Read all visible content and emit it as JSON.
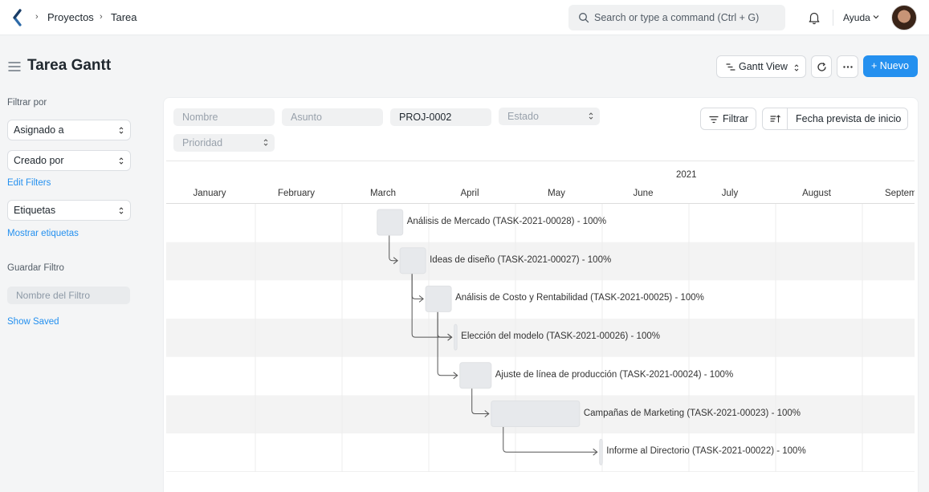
{
  "navbar": {
    "breadcrumbs": [
      "Proyectos",
      "Tarea"
    ],
    "search_placeholder": "Search or type a command (Ctrl + G)",
    "help_label": "Ayuda"
  },
  "page": {
    "title": "Tarea Gantt",
    "view_label": "Gantt View",
    "new_label": "+ Nuevo"
  },
  "sidebar": {
    "filter_by": "Filtrar por",
    "assigned_to": "Asignado a",
    "created_by": "Creado por",
    "edit_filters": "Edit Filters",
    "tags": "Etiquetas",
    "show_tags": "Mostrar etiquetas",
    "save_filter": "Guardar Filtro",
    "filter_name_placeholder": "Nombre del Filtro",
    "show_saved": "Show Saved"
  },
  "filters": {
    "name_placeholder": "Nombre",
    "subject_placeholder": "Asunto",
    "project_value": "PROJ-0002",
    "status_placeholder": "Estado",
    "priority_placeholder": "Prioridad",
    "filter_button": "Filtrar",
    "sort_label": "Fecha prevista de inicio"
  },
  "gantt": {
    "year": "2021",
    "months": [
      "January",
      "February",
      "March",
      "April",
      "May",
      "June",
      "July",
      "August",
      "Septemb"
    ],
    "tasks": [
      {
        "label": "Análisis de Mercado (TASK-2021-00028) - 100%",
        "start": "2021-03-16",
        "end": "2021-03-25"
      },
      {
        "label": "Ideas de diseño (TASK-2021-00027) - 100%",
        "start": "2021-03-24",
        "end": "2021-04-02"
      },
      {
        "label": "Análisis de Costo y Rentabilidad (TASK-2021-00025) - 100%",
        "start": "2021-04-02",
        "end": "2021-04-11"
      },
      {
        "label": "Elección del modelo (TASK-2021-00026) - 100%",
        "start": "2021-04-12",
        "end": "2021-04-13"
      },
      {
        "label": "Ajuste de línea de producción (TASK-2021-00024) - 100%",
        "start": "2021-04-14",
        "end": "2021-04-25"
      },
      {
        "label": "Campañas de Marketing (TASK-2021-00023) - 100%",
        "start": "2021-04-25",
        "end": "2021-05-26"
      },
      {
        "label": "Informe al Directorio (TASK-2021-00022) - 100%",
        "start": "2021-06-02",
        "end": "2021-06-03"
      }
    ],
    "dependencies": [
      [
        0,
        1
      ],
      [
        1,
        2
      ],
      [
        1,
        3
      ],
      [
        2,
        3
      ],
      [
        2,
        4
      ],
      [
        4,
        5
      ],
      [
        5,
        6
      ]
    ]
  },
  "colors": {
    "accent": "#2490ef",
    "bar": "#e7e9ec",
    "row_alt": "#f3f3f3"
  }
}
